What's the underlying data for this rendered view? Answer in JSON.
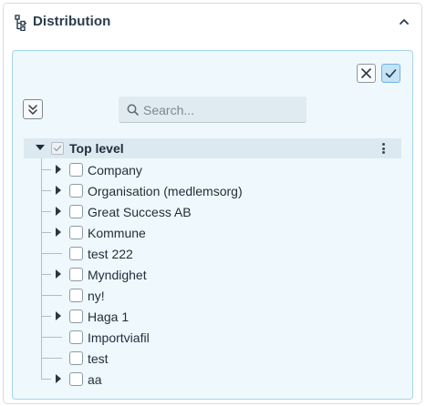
{
  "header": {
    "title": "Distribution",
    "icon": "sitemap-icon",
    "collapse_icon": "chevron-up-icon"
  },
  "toolbar": {
    "cancel_icon": "close-icon",
    "confirm_icon": "check-icon",
    "expand_all_icon": "double-chevron-down-icon"
  },
  "search": {
    "placeholder": "Search...",
    "value": ""
  },
  "tree": {
    "root": {
      "label": "Top level",
      "expanded": true,
      "checked": true,
      "menu_icon": "kebab-menu-icon"
    },
    "items": [
      {
        "label": "Company",
        "has_children": true
      },
      {
        "label": "Organisation (medlemsorg)",
        "has_children": true
      },
      {
        "label": "Great Success AB",
        "has_children": true
      },
      {
        "label": "Kommune",
        "has_children": true
      },
      {
        "label": "test 222",
        "has_children": false
      },
      {
        "label": "Myndighet",
        "has_children": true
      },
      {
        "label": "ny!",
        "has_children": false
      },
      {
        "label": "Haga 1",
        "has_children": true
      },
      {
        "label": "Importviafil",
        "has_children": false
      },
      {
        "label": "test",
        "has_children": false
      },
      {
        "label": "aa",
        "has_children": true
      }
    ]
  },
  "colors": {
    "panel_bg": "#eff8fc",
    "panel_border": "#a6d4ec",
    "confirm_bg": "#c4e3f4",
    "root_row_bg": "#dde9f0",
    "text": "#1f2d3a"
  }
}
